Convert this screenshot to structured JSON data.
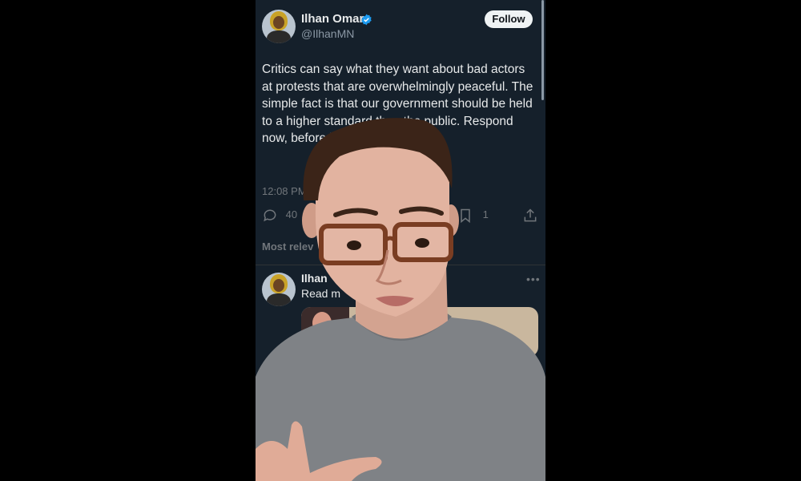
{
  "tweet": {
    "author_name": "Ilhan Omar",
    "author_handle": "@IlhanMN",
    "follow_label": "Follow",
    "text": "Critics can say what they want about bad actors at protests that are overwhelmingly peaceful. The simple fact is that our government should be held to a higher standard than the public. Respond now, before it is too late",
    "timestamp": "12:08 PM ·",
    "reply_count": "40",
    "bookmark_count": "1"
  },
  "section": {
    "label": "Most relev"
  },
  "reply": {
    "author_name": "Ilhan",
    "time": "h",
    "text": "Read m"
  },
  "colors": {
    "background": "#15202b",
    "verified": "#1d9bf0",
    "text_primary": "#e7e9ea",
    "text_secondary": "#71767b"
  },
  "icons": [
    "verified-badge-icon",
    "reply-icon",
    "bookmark-icon",
    "share-icon",
    "more-icon"
  ]
}
